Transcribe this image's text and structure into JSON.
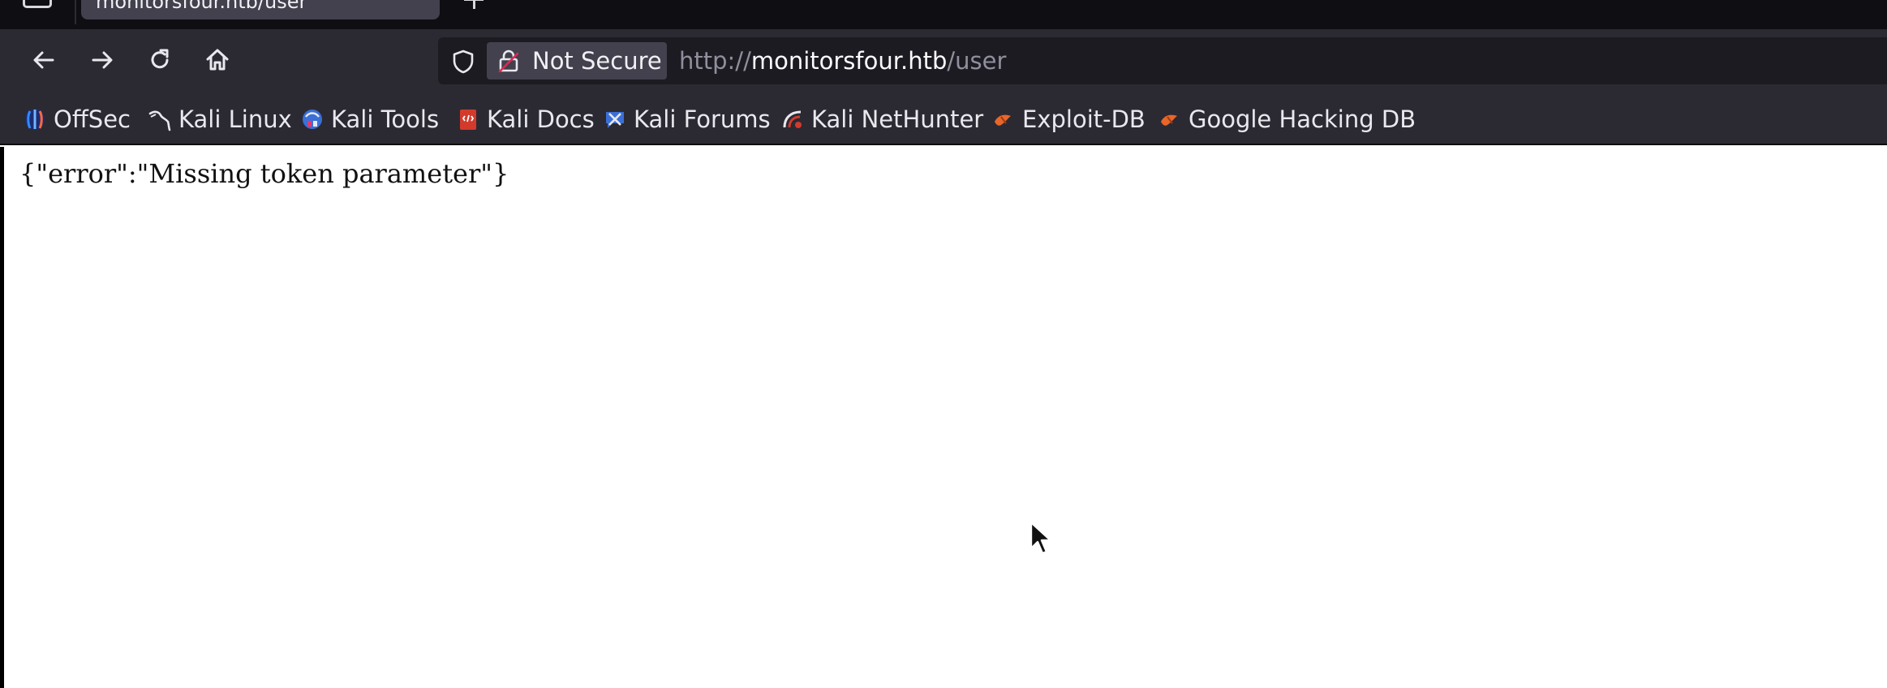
{
  "tab": {
    "title": "monitorsfour.htb/user"
  },
  "navigation": {
    "back": "back-arrow-icon",
    "forward": "forward-arrow-icon",
    "reload": "reload-icon",
    "home": "home-icon"
  },
  "urlbar": {
    "security_label": "Not Secure",
    "url_scheme": "http://",
    "url_host": "monitorsfour.htb",
    "url_path": "/user"
  },
  "bookmarks": [
    {
      "label": "OffSec",
      "icon": "offsec-icon"
    },
    {
      "label": "Kali Linux",
      "icon": "kali-dragon-icon"
    },
    {
      "label": "Kali Tools",
      "icon": "kali-tools-icon"
    },
    {
      "label": "Kali Docs",
      "icon": "kali-docs-icon"
    },
    {
      "label": "Kali Forums",
      "icon": "kali-forums-icon"
    },
    {
      "label": "Kali NetHunter",
      "icon": "kali-nethunter-icon"
    },
    {
      "label": "Exploit-DB",
      "icon": "exploit-db-icon"
    },
    {
      "label": "Google Hacking DB",
      "icon": "google-hacking-db-icon"
    }
  ],
  "page": {
    "body_text": "{\"error\":\"Missing token parameter\"}"
  },
  "colors": {
    "chrome_bg": "#2b2a33",
    "tabstrip_bg": "#0f0f13",
    "urlbar_bg": "#1c1b22",
    "page_bg": "#ffffff"
  }
}
